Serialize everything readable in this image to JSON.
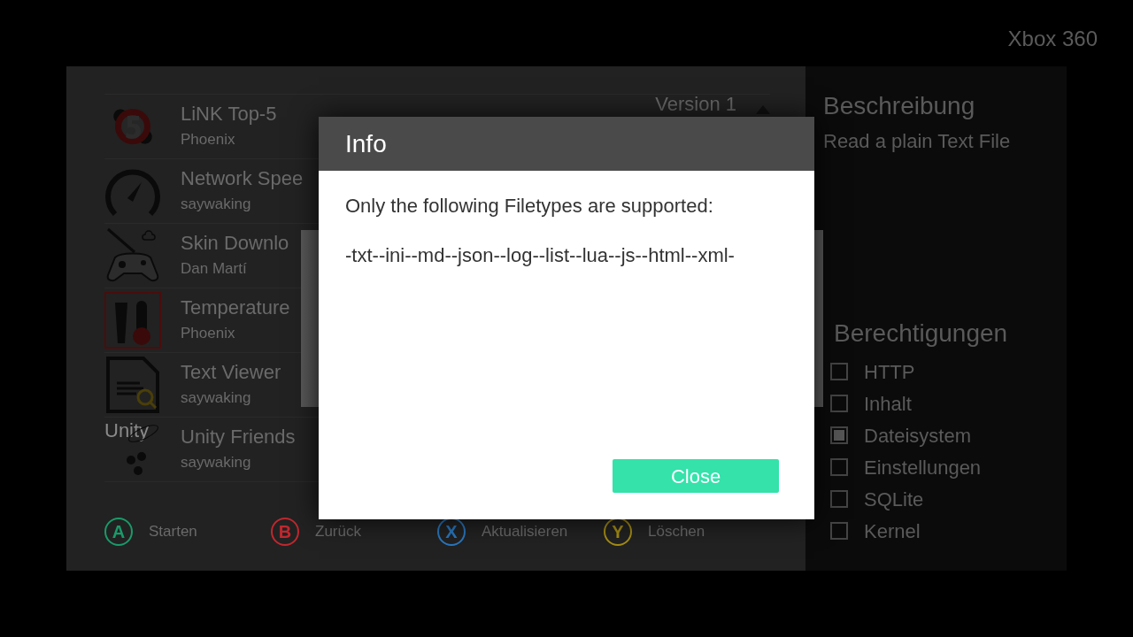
{
  "console_label": "Xbox 360",
  "apps": [
    {
      "title": "LiNK Top-5",
      "author": "Phoenix",
      "kind": "five",
      "version": "Version 1"
    },
    {
      "title": "Network Spee",
      "author": "saywaking",
      "kind": "gauge"
    },
    {
      "title": "Skin Downlo",
      "author": "Dan Martí",
      "kind": "controller"
    },
    {
      "title": "Temperature",
      "author": "Phoenix",
      "kind": "thermo"
    },
    {
      "title": "Text Viewer",
      "author": "saywaking",
      "kind": "doc"
    },
    {
      "title": "Unity Friends",
      "author": "saywaking",
      "kind": "unity",
      "icon_text": "Unity"
    }
  ],
  "legend": [
    {
      "key": "A",
      "label": "Starten",
      "color": "#1a9a6a"
    },
    {
      "key": "B",
      "label": "Zurück",
      "color": "#c0282e"
    },
    {
      "key": "X",
      "label": "Aktualisieren",
      "color": "#2a78c0"
    },
    {
      "key": "Y",
      "label": "Löschen",
      "color": "#a88f14"
    }
  ],
  "details": {
    "description_heading": "Beschreibung",
    "description": "Read a plain Text File",
    "permissions_heading": "Berechtigungen",
    "permissions": [
      {
        "label": "HTTP",
        "checked": false
      },
      {
        "label": "Inhalt",
        "checked": false
      },
      {
        "label": "Dateisystem",
        "checked": true
      },
      {
        "label": "Einstellungen",
        "checked": false
      },
      {
        "label": "SQLite",
        "checked": false
      },
      {
        "label": "Kernel",
        "checked": false
      }
    ]
  },
  "dialog": {
    "title": "Info",
    "message": "Only the following Filetypes are supported:",
    "filetypes": "-txt--ini--md--json--log--list--lua--js--html--xml-",
    "button": "Close"
  }
}
